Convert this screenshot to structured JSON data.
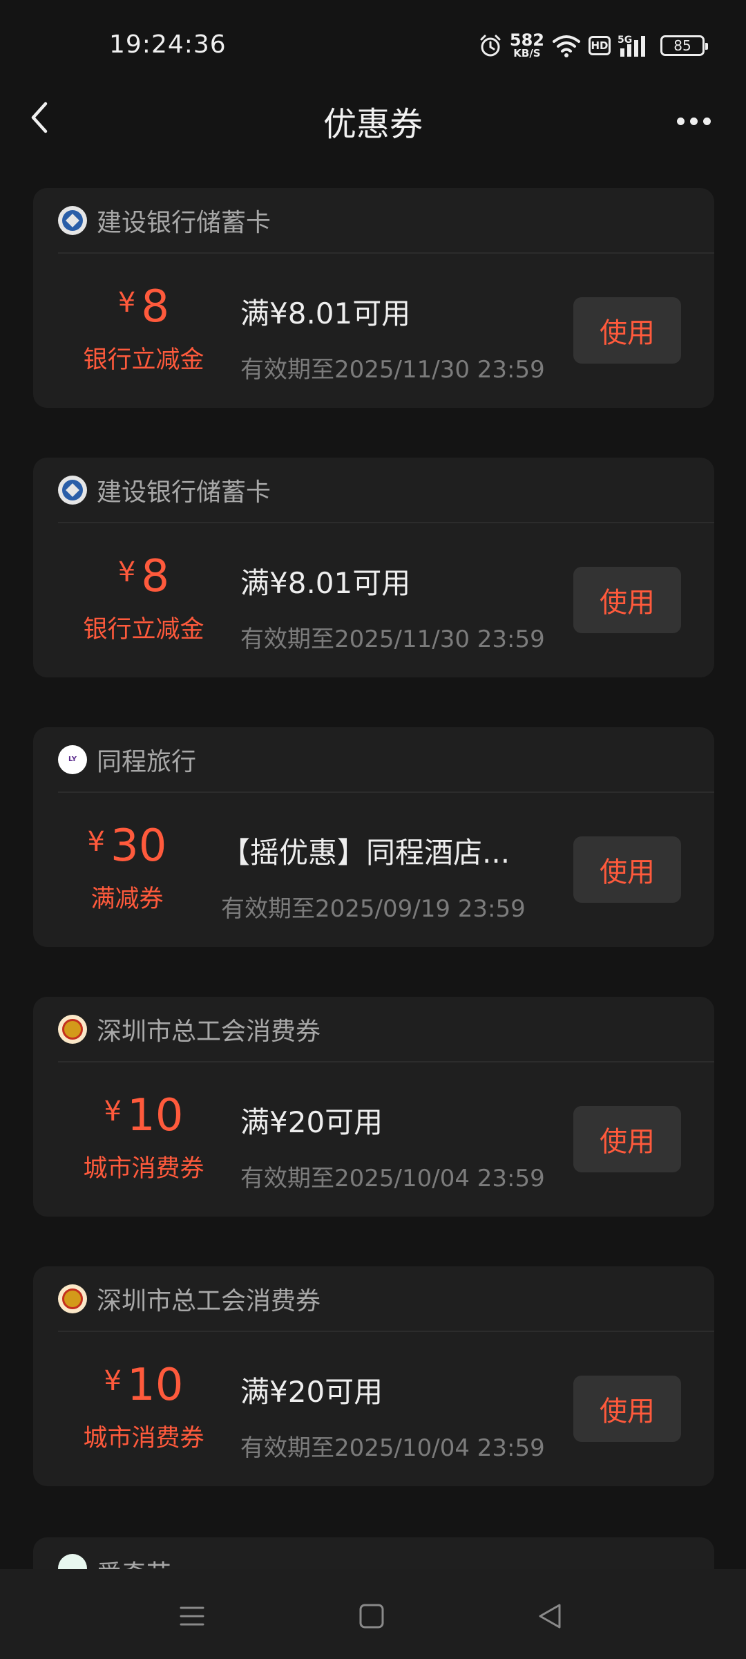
{
  "status_bar": {
    "time": "19:24:36",
    "net_speed": "582",
    "net_unit": "KB/S",
    "hd": "HD",
    "network": "5G",
    "battery": "85"
  },
  "header": {
    "title": "优惠券"
  },
  "coupons": [
    {
      "brand": "建设银行储蓄卡",
      "brand_icon": "ccb-logo",
      "currency": "¥",
      "amount": "8",
      "amount_label": "银行立减金",
      "title": "满¥8.01可用",
      "validity": "有效期至2025/11/30 23:59",
      "button": "使用"
    },
    {
      "brand": "建设银行储蓄卡",
      "brand_icon": "ccb-logo",
      "currency": "¥",
      "amount": "8",
      "amount_label": "银行立减金",
      "title": "满¥8.01可用",
      "validity": "有效期至2025/11/30 23:59",
      "button": "使用"
    },
    {
      "brand": "同程旅行",
      "brand_icon": "ly-logo",
      "currency": "¥",
      "amount": "30",
      "amount_label": "满减券",
      "title": "【摇优惠】同程酒店...",
      "validity": "有效期至2025/09/19 23:59",
      "button": "使用"
    },
    {
      "brand": "深圳市总工会消费券",
      "brand_icon": "union-logo",
      "currency": "¥",
      "amount": "10",
      "amount_label": "城市消费券",
      "title": "满¥20可用",
      "validity": "有效期至2025/10/04 23:59",
      "button": "使用"
    },
    {
      "brand": "深圳市总工会消费券",
      "brand_icon": "union-logo",
      "currency": "¥",
      "amount": "10",
      "amount_label": "城市消费券",
      "title": "满¥20可用",
      "validity": "有效期至2025/10/04 23:59",
      "button": "使用"
    }
  ],
  "partial_coupon": {
    "brand": "爱奇艺"
  },
  "colors": {
    "accent": "#ff5a3c",
    "card_bg": "#1f1f1f",
    "page_bg": "#141414"
  }
}
